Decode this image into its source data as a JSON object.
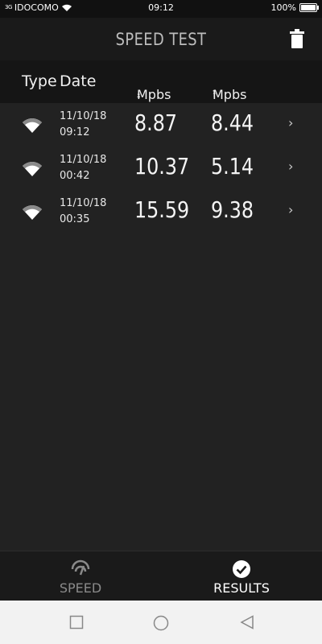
{
  "status_bar": {
    "signal_text": "3G",
    "carrier": "IDOCOMO",
    "time": "09:12",
    "battery": "100%"
  },
  "header": {
    "title": "SPEED TEST",
    "delete_icon": "trash-icon"
  },
  "columns": {
    "type": "Type",
    "date": "Date",
    "download": "Mpbs",
    "upload": "Mpbs"
  },
  "results": [
    {
      "date": "11/10/18",
      "time": "09:12",
      "download": "8.87",
      "upload": "8.44"
    },
    {
      "date": "11/10/18",
      "time": "00:42",
      "download": "10.37",
      "upload": "5.14"
    },
    {
      "date": "11/10/18",
      "time": "00:35",
      "download": "15.59",
      "upload": "9.38"
    }
  ],
  "bottom_nav": {
    "speed_label": "SPEED",
    "results_label": "RESULTS",
    "active": "results"
  },
  "colors": {
    "background": "#222222",
    "header": "#1a1a1a",
    "text": "#ffffff",
    "muted": "#8a8a8a"
  }
}
